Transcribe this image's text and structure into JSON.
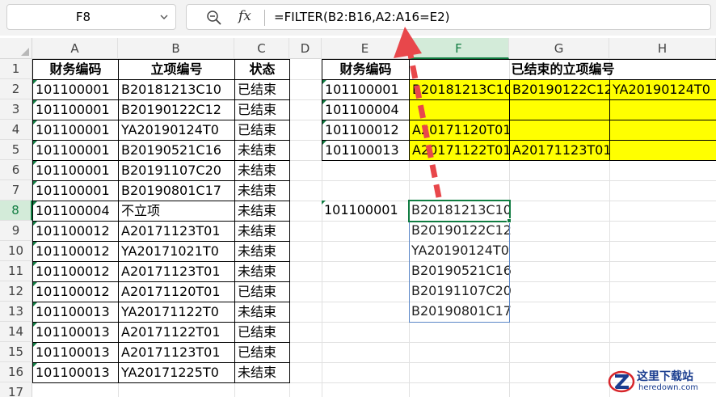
{
  "name_box": "F8",
  "formula_bar": {
    "fx_label": "fx",
    "formula": "=FILTER(B2:B16,A2:A16=E2)"
  },
  "selected_column": "F",
  "selected_row": "8",
  "columns": [
    "A",
    "B",
    "C",
    "D",
    "E",
    "F",
    "G",
    "H"
  ],
  "rows": [
    "1",
    "2",
    "3",
    "4",
    "5",
    "6",
    "7",
    "8",
    "9",
    "10",
    "11",
    "12",
    "13",
    "14",
    "15",
    "16",
    "17"
  ],
  "left_table": {
    "headers": [
      "财务编码",
      "立项编号",
      "状态"
    ],
    "rows": [
      [
        "101100001",
        "B20181213C10",
        "已结束"
      ],
      [
        "101100001",
        "B20190122C12",
        "已结束"
      ],
      [
        "101100001",
        "YA20190124T0",
        "已结束"
      ],
      [
        "101100001",
        "B20190521C16",
        "未结束"
      ],
      [
        "101100001",
        "B20191107C20",
        "未结束"
      ],
      [
        "101100001",
        "B20190801C17",
        "未结束"
      ],
      [
        "101100004",
        "不立项",
        "未结束"
      ],
      [
        "101100012",
        "A20171123T01",
        "未结束"
      ],
      [
        "101100012",
        "YA20171021T0",
        "未结束"
      ],
      [
        "101100012",
        "A20171123T01",
        "未结束"
      ],
      [
        "101100012",
        "A20171120T01",
        "已结束"
      ],
      [
        "101100013",
        "YA20171122T0",
        "未结束"
      ],
      [
        "101100013",
        "A20171122T01",
        "已结束"
      ],
      [
        "101100013",
        "A20171123T01",
        "已结束"
      ],
      [
        "101100013",
        "YA20171225T0",
        "未结束"
      ]
    ]
  },
  "right_table": {
    "header_code": "财务编码",
    "header_merged": "已结束的立项编号",
    "rows": [
      [
        "101100001",
        "B20181213C10",
        "B20190122C12",
        "YA20190124T0"
      ],
      [
        "101100004",
        "",
        "",
        ""
      ],
      [
        "101100012",
        "A20171120T01",
        "",
        ""
      ],
      [
        "101100013",
        "A20171122T01",
        "A20171123T01",
        ""
      ]
    ]
  },
  "lookup": {
    "code": "101100001",
    "results": [
      "B20181213C10",
      "B20190122C12",
      "YA20190124T0",
      "B20190521C16",
      "B20191107C20",
      "B20190801C17"
    ]
  },
  "colors": {
    "highlight": "#ffff00",
    "selection": "#107c41",
    "arrow": "#e8474b"
  },
  "watermark": {
    "name": "这里下载站",
    "domain": "heredown.com"
  }
}
